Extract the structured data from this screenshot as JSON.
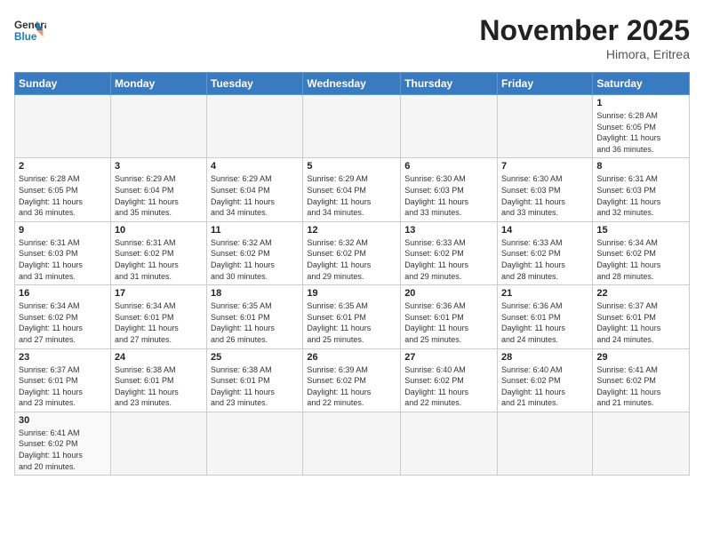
{
  "logo": {
    "general": "General",
    "blue": "Blue"
  },
  "header": {
    "month": "November 2025",
    "location": "Himora, Eritrea"
  },
  "weekdays": [
    "Sunday",
    "Monday",
    "Tuesday",
    "Wednesday",
    "Thursday",
    "Friday",
    "Saturday"
  ],
  "weeks": [
    [
      {
        "day": "",
        "info": ""
      },
      {
        "day": "",
        "info": ""
      },
      {
        "day": "",
        "info": ""
      },
      {
        "day": "",
        "info": ""
      },
      {
        "day": "",
        "info": ""
      },
      {
        "day": "",
        "info": ""
      },
      {
        "day": "1",
        "info": "Sunrise: 6:28 AM\nSunset: 6:05 PM\nDaylight: 11 hours\nand 36 minutes."
      }
    ],
    [
      {
        "day": "2",
        "info": "Sunrise: 6:28 AM\nSunset: 6:05 PM\nDaylight: 11 hours\nand 36 minutes."
      },
      {
        "day": "3",
        "info": "Sunrise: 6:29 AM\nSunset: 6:04 PM\nDaylight: 11 hours\nand 35 minutes."
      },
      {
        "day": "4",
        "info": "Sunrise: 6:29 AM\nSunset: 6:04 PM\nDaylight: 11 hours\nand 34 minutes."
      },
      {
        "day": "5",
        "info": "Sunrise: 6:29 AM\nSunset: 6:04 PM\nDaylight: 11 hours\nand 34 minutes."
      },
      {
        "day": "6",
        "info": "Sunrise: 6:30 AM\nSunset: 6:03 PM\nDaylight: 11 hours\nand 33 minutes."
      },
      {
        "day": "7",
        "info": "Sunrise: 6:30 AM\nSunset: 6:03 PM\nDaylight: 11 hours\nand 33 minutes."
      },
      {
        "day": "8",
        "info": "Sunrise: 6:31 AM\nSunset: 6:03 PM\nDaylight: 11 hours\nand 32 minutes."
      }
    ],
    [
      {
        "day": "9",
        "info": "Sunrise: 6:31 AM\nSunset: 6:03 PM\nDaylight: 11 hours\nand 31 minutes."
      },
      {
        "day": "10",
        "info": "Sunrise: 6:31 AM\nSunset: 6:02 PM\nDaylight: 11 hours\nand 31 minutes."
      },
      {
        "day": "11",
        "info": "Sunrise: 6:32 AM\nSunset: 6:02 PM\nDaylight: 11 hours\nand 30 minutes."
      },
      {
        "day": "12",
        "info": "Sunrise: 6:32 AM\nSunset: 6:02 PM\nDaylight: 11 hours\nand 29 minutes."
      },
      {
        "day": "13",
        "info": "Sunrise: 6:33 AM\nSunset: 6:02 PM\nDaylight: 11 hours\nand 29 minutes."
      },
      {
        "day": "14",
        "info": "Sunrise: 6:33 AM\nSunset: 6:02 PM\nDaylight: 11 hours\nand 28 minutes."
      },
      {
        "day": "15",
        "info": "Sunrise: 6:34 AM\nSunset: 6:02 PM\nDaylight: 11 hours\nand 28 minutes."
      }
    ],
    [
      {
        "day": "16",
        "info": "Sunrise: 6:34 AM\nSunset: 6:02 PM\nDaylight: 11 hours\nand 27 minutes."
      },
      {
        "day": "17",
        "info": "Sunrise: 6:34 AM\nSunset: 6:01 PM\nDaylight: 11 hours\nand 27 minutes."
      },
      {
        "day": "18",
        "info": "Sunrise: 6:35 AM\nSunset: 6:01 PM\nDaylight: 11 hours\nand 26 minutes."
      },
      {
        "day": "19",
        "info": "Sunrise: 6:35 AM\nSunset: 6:01 PM\nDaylight: 11 hours\nand 25 minutes."
      },
      {
        "day": "20",
        "info": "Sunrise: 6:36 AM\nSunset: 6:01 PM\nDaylight: 11 hours\nand 25 minutes."
      },
      {
        "day": "21",
        "info": "Sunrise: 6:36 AM\nSunset: 6:01 PM\nDaylight: 11 hours\nand 24 minutes."
      },
      {
        "day": "22",
        "info": "Sunrise: 6:37 AM\nSunset: 6:01 PM\nDaylight: 11 hours\nand 24 minutes."
      }
    ],
    [
      {
        "day": "23",
        "info": "Sunrise: 6:37 AM\nSunset: 6:01 PM\nDaylight: 11 hours\nand 23 minutes."
      },
      {
        "day": "24",
        "info": "Sunrise: 6:38 AM\nSunset: 6:01 PM\nDaylight: 11 hours\nand 23 minutes."
      },
      {
        "day": "25",
        "info": "Sunrise: 6:38 AM\nSunset: 6:01 PM\nDaylight: 11 hours\nand 23 minutes."
      },
      {
        "day": "26",
        "info": "Sunrise: 6:39 AM\nSunset: 6:02 PM\nDaylight: 11 hours\nand 22 minutes."
      },
      {
        "day": "27",
        "info": "Sunrise: 6:40 AM\nSunset: 6:02 PM\nDaylight: 11 hours\nand 22 minutes."
      },
      {
        "day": "28",
        "info": "Sunrise: 6:40 AM\nSunset: 6:02 PM\nDaylight: 11 hours\nand 21 minutes."
      },
      {
        "day": "29",
        "info": "Sunrise: 6:41 AM\nSunset: 6:02 PM\nDaylight: 11 hours\nand 21 minutes."
      }
    ],
    [
      {
        "day": "30",
        "info": "Sunrise: 6:41 AM\nSunset: 6:02 PM\nDaylight: 11 hours\nand 20 minutes."
      },
      {
        "day": "",
        "info": ""
      },
      {
        "day": "",
        "info": ""
      },
      {
        "day": "",
        "info": ""
      },
      {
        "day": "",
        "info": ""
      },
      {
        "day": "",
        "info": ""
      },
      {
        "day": "",
        "info": ""
      }
    ]
  ]
}
